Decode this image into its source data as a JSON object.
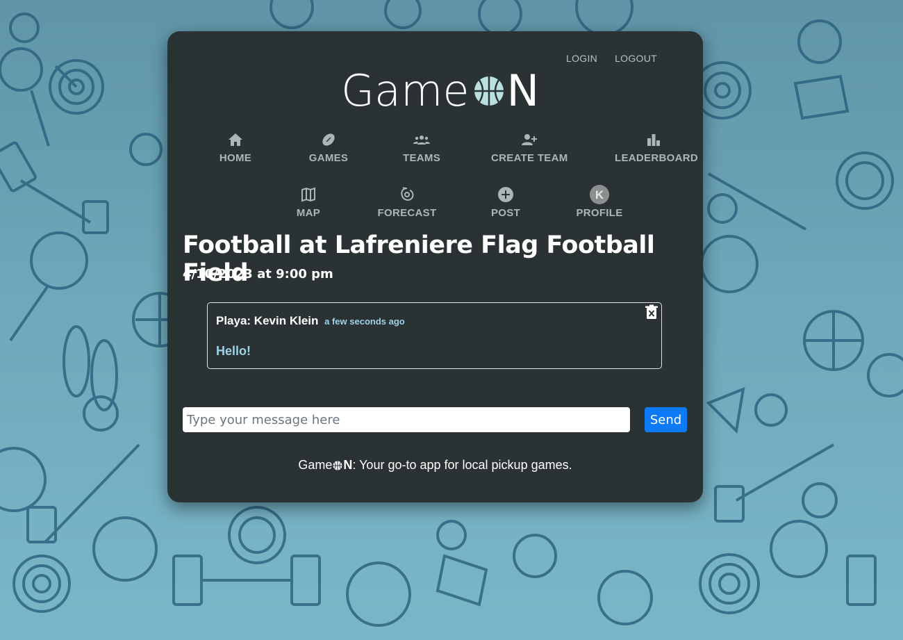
{
  "auth": {
    "login_label": "LOGIN",
    "logout_label": "LOGOUT"
  },
  "brand": {
    "prefix": "Game",
    "suffix": "N"
  },
  "nav": {
    "home": "HOME",
    "games": "GAMES",
    "teams": "TEAMS",
    "create_team": "CREATE TEAM",
    "leaderboard": "LEADERBOARD",
    "map": "MAP",
    "forecast": "FORECAST",
    "post": "POST",
    "profile": "PROFILE",
    "profile_initial": "K"
  },
  "game": {
    "title": "Football at Lafreniere Flag Football Field",
    "datetime": "4/10/2023 at 9:00 pm"
  },
  "messages": [
    {
      "author": "Playa: Kevin Klein",
      "time": "a few seconds ago",
      "body": "Hello!"
    }
  ],
  "chat": {
    "placeholder": "Type your message here",
    "send_label": "Send"
  },
  "footer": {
    "brand_prefix": "Game",
    "brand_suffix": "N",
    "tagline": ": Your go-to app for local pickup games."
  },
  "colors": {
    "card_bg": "#2b3234",
    "accent": "#0d7bf7",
    "timestamp": "#9ed2e6"
  }
}
